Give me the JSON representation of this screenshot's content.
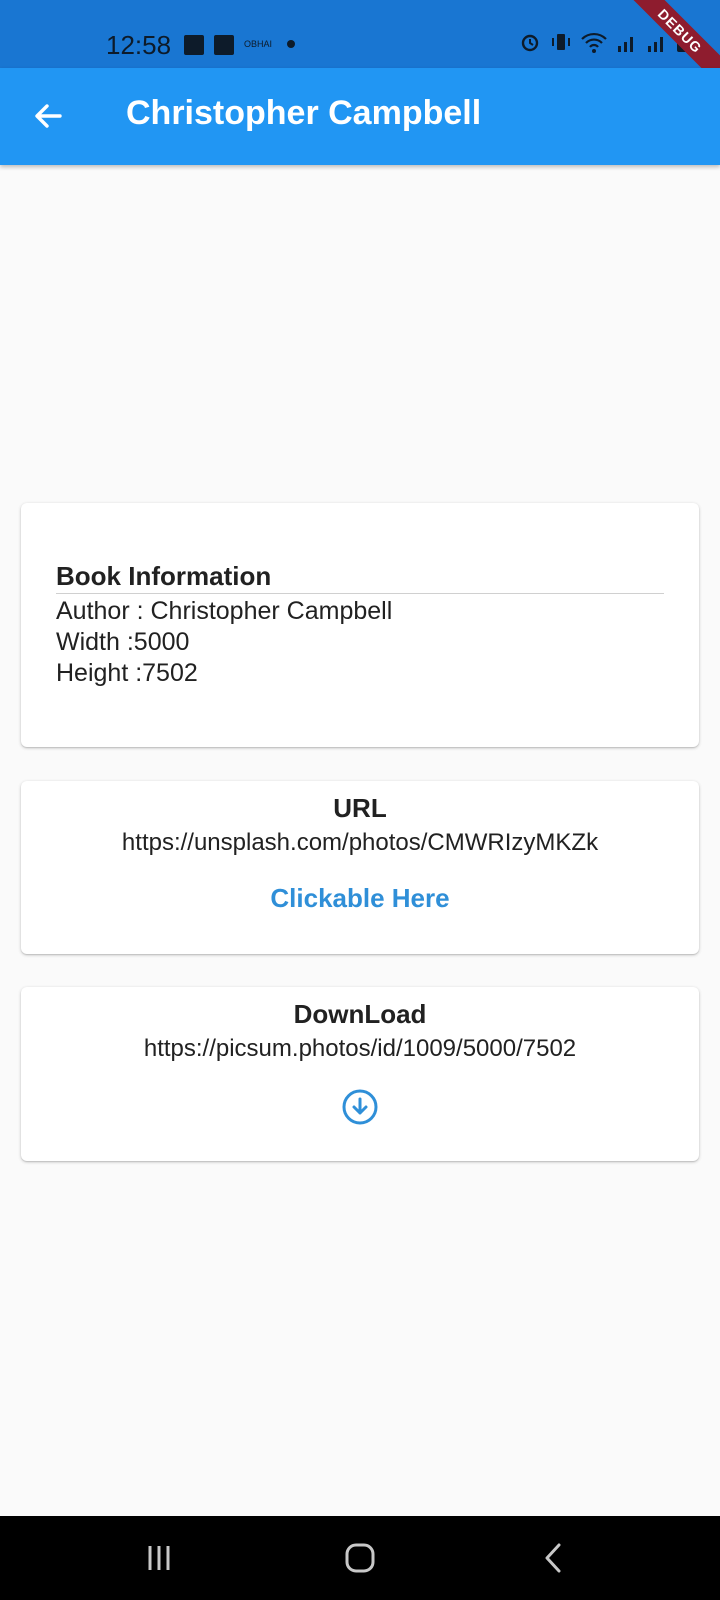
{
  "status_bar": {
    "time": "12:58",
    "small_label": "OBHAI",
    "debug_label": "DEBUG"
  },
  "app_bar": {
    "title": "Christopher Campbell",
    "back_icon": "arrow-back-icon"
  },
  "book_info": {
    "title": "Book Information",
    "author_line": "Author : Christopher Campbell",
    "width_line": "Width :5000",
    "height_line": "Height :7502"
  },
  "url_card": {
    "heading": "URL",
    "url": "https://unsplash.com/photos/CMWRIzyMKZk",
    "link_label": "Clickable Here"
  },
  "download_card": {
    "heading": "DownLoad",
    "url": "https://picsum.photos/id/1009/5000/7502",
    "icon": "download-circle-icon"
  },
  "colors": {
    "primary": "#2196f3",
    "status_bar": "#1976d2",
    "link": "#2f8fd8"
  }
}
